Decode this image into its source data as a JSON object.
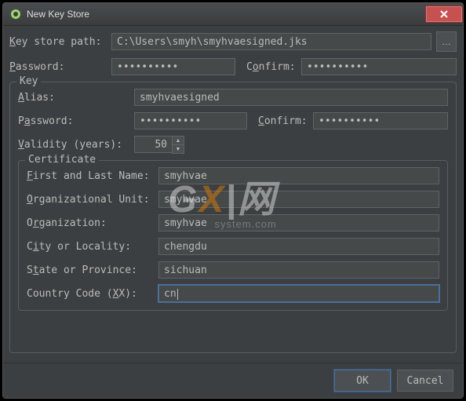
{
  "window": {
    "title": "New Key Store"
  },
  "path": {
    "label": "Key store path:",
    "value": "C:\\Users\\smyh\\smyhvaesigned.jks",
    "browse": "…"
  },
  "store": {
    "password_label": "Password:",
    "password_value": "••••••••••",
    "confirm_label": "Confirm:",
    "confirm_value": "••••••••••"
  },
  "key_group": {
    "legend": "Key",
    "alias_label": "Alias:",
    "alias_value": "smyhvaesigned",
    "password_label": "Password:",
    "password_value": "••••••••••",
    "confirm_label": "Confirm:",
    "confirm_value": "••••••••••",
    "validity_label": "Validity (years):",
    "validity_value": "50"
  },
  "cert": {
    "legend": "Certificate",
    "first_last_label": "First and Last Name:",
    "first_last_value": "smyhvae",
    "org_unit_label": "Organizational Unit:",
    "org_unit_value": "smyhvae",
    "org_label": "Organization:",
    "org_value": "smyhvae",
    "city_label": "City or Locality:",
    "city_value": "chengdu",
    "state_label": "State or Province:",
    "state_value": "sichuan",
    "country_label": "Country Code (XX):",
    "country_value": "cn"
  },
  "buttons": {
    "ok": "OK",
    "cancel": "Cancel"
  },
  "watermark": {
    "g": "G",
    "x": "X",
    "net": "|网",
    "sub": "system.com"
  }
}
